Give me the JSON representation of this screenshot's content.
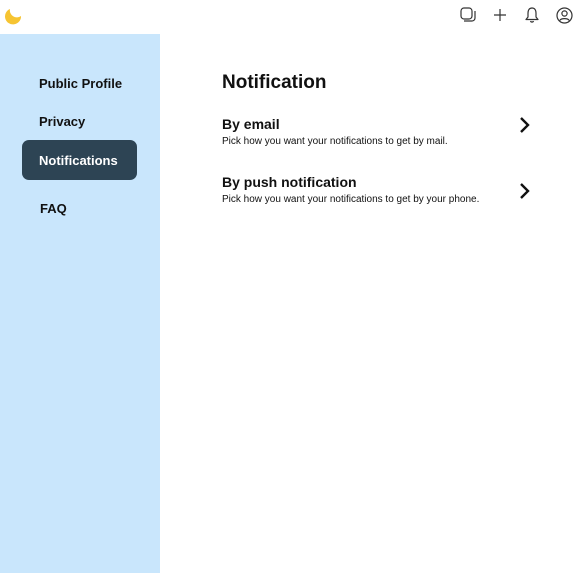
{
  "header": {
    "icons": [
      "yellow-circle-logo",
      "stack-icon",
      "plus-icon",
      "bell-icon",
      "user-icon"
    ],
    "accent_color": "#f6c432"
  },
  "sidebar": {
    "background": "#c9e6fc",
    "active_background": "#2d4454",
    "items": [
      {
        "label": "Public Profile"
      },
      {
        "label": "Privacy"
      },
      {
        "label": "Notifications",
        "active": true
      },
      {
        "label": "FAQ"
      }
    ]
  },
  "main": {
    "title": "Notification",
    "settings": [
      {
        "title": "By email",
        "description": "Pick how you want your notifications to get by mail."
      },
      {
        "title": "By push notification",
        "description": "Pick how you want your notifications to get by your phone."
      }
    ]
  }
}
